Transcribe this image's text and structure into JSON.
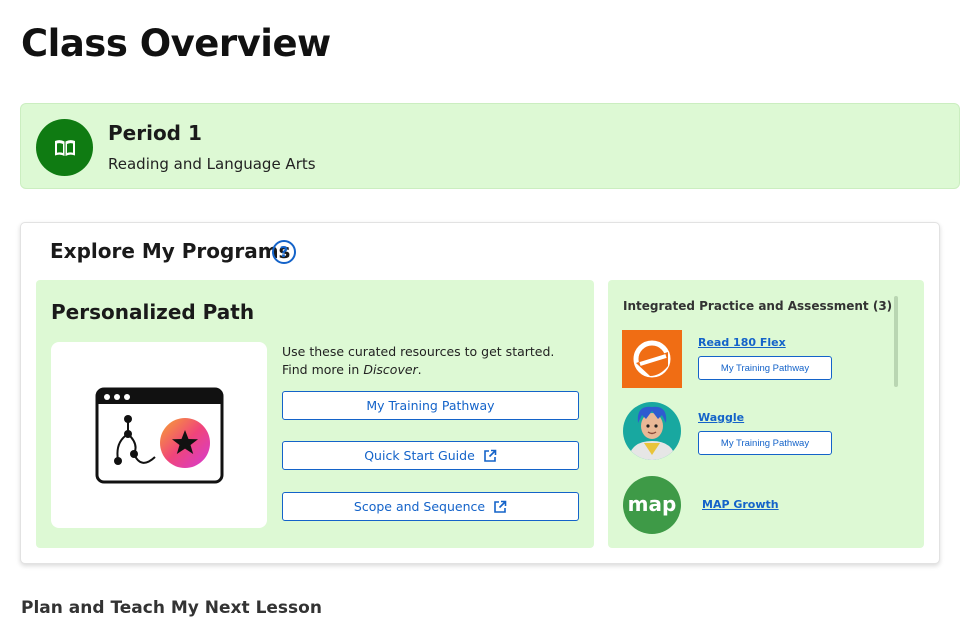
{
  "page": {
    "title": "Class Overview"
  },
  "class_banner": {
    "name": "Period 1",
    "subject": "Reading and Language Arts",
    "icon": "book-icon",
    "accent": "#0f7b12",
    "background": "#ddf9d4"
  },
  "explore": {
    "title": "Explore My Programs",
    "help_icon": "?",
    "personalized_path": {
      "title": "Personalized Path",
      "description_prefix": "Use these curated resources to get started. Find more in ",
      "description_emphasis": "Discover",
      "description_suffix": ".",
      "buttons": [
        {
          "label": "My Training Pathway",
          "external": false
        },
        {
          "label": "Quick Start Guide",
          "external": true
        },
        {
          "label": "Scope and Sequence",
          "external": true
        }
      ]
    },
    "integrated": {
      "title": "Integrated Practice and Assessment (3)",
      "programs": [
        {
          "name": "Read 180 Flex",
          "button": "My Training Pathway",
          "logo": "read180-logo",
          "logo_color": "#f06d14"
        },
        {
          "name": "Waggle",
          "button": "My Training Pathway",
          "logo": "waggle-avatar-logo"
        },
        {
          "name": "MAP Growth",
          "logo": "map-logo",
          "logo_text": "map",
          "logo_color": "#3e9a47"
        }
      ]
    }
  },
  "next_lesson": {
    "title": "Plan and Teach My Next Lesson"
  },
  "colors": {
    "primary_blue": "#1463c9",
    "green_bg": "#ddf9d4"
  }
}
